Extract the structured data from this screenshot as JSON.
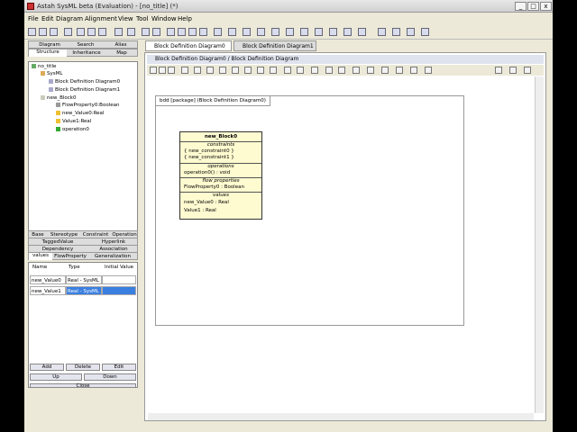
{
  "window": {
    "title": "Astah SysML beta (Evaluation) - [no_title] (*)"
  },
  "menu": [
    "File",
    "Edit",
    "Diagram",
    "Alignment",
    "View",
    "Tool",
    "Window",
    "Help"
  ],
  "left_tabs_top": [
    "Diagram",
    "Search",
    "Alias"
  ],
  "left_tabs_second": [
    "Structure",
    "Inheritance",
    "Map"
  ],
  "tree": [
    "no_title",
    "SysML",
    "Block Definition Diagram0",
    "Block Definition Diagram1",
    "new_Block0",
    "FlowProperty0:Boolean",
    "new_Value0:Real",
    "Value1:Real",
    "operation0"
  ],
  "prop_tabs_row1": [
    "Base",
    "Stereotype",
    "Constraint",
    "Operation"
  ],
  "prop_tabs_row2": [
    "TaggedValue",
    "Hyperlink"
  ],
  "prop_tabs_row3": [
    "Dependency",
    "Association"
  ],
  "prop_tabs_row4": [
    "values",
    "FlowProperty",
    "Generalization"
  ],
  "values_table": {
    "headers": [
      "Name",
      "Type",
      "Initial Value"
    ],
    "rows": [
      {
        "name": "new_Value0",
        "type": "Real - SysML",
        "initial": ""
      },
      {
        "name": "new_Value1",
        "type": "Real - SysML",
        "initial": ""
      }
    ]
  },
  "buttons": {
    "add": "Add",
    "delete": "Delete",
    "edit": "Edit",
    "up": "Up",
    "down": "Down",
    "close": "Close"
  },
  "doc_tabs": [
    "Block Definition Diagram0",
    "Block Definition Diagram1"
  ],
  "panel_title": "Block Definition Diagram0 / Block Definition Diagram",
  "frame_label": "bdd [package] (Block Definition Diagram0)",
  "block": {
    "name": "new_Block0",
    "constraints_label": "constraints",
    "constraints": [
      "{ new_constraint0 }",
      "{ new_constraint1 }"
    ],
    "operations_label": "operations",
    "operations": [
      "operation0() : void"
    ],
    "flow_label": "flow properties",
    "flow": [
      "FlowProperty0 : Boolean"
    ],
    "values_label": "values",
    "values": [
      "new_Value0 : Real",
      "Value1 : Real"
    ]
  }
}
